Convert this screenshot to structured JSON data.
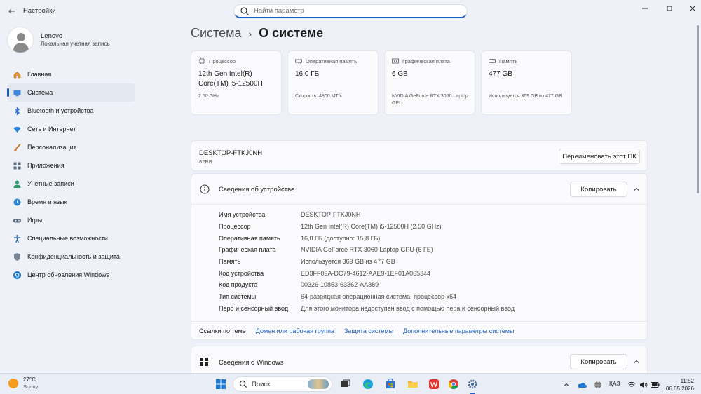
{
  "window": {
    "title": "Настройки",
    "search_placeholder": "Найти параметр"
  },
  "profile": {
    "name": "Lenovo",
    "account_type": "Локальная учетная запись"
  },
  "sidebar": {
    "items": [
      {
        "label": "Главная",
        "icon": "home-icon"
      },
      {
        "label": "Система",
        "icon": "system-icon",
        "active": true
      },
      {
        "label": "Bluetooth и устройства",
        "icon": "bluetooth-icon"
      },
      {
        "label": "Сеть и Интернет",
        "icon": "wifi-icon"
      },
      {
        "label": "Персонализация",
        "icon": "brush-icon"
      },
      {
        "label": "Приложения",
        "icon": "apps-icon"
      },
      {
        "label": "Учетные записи",
        "icon": "accounts-icon"
      },
      {
        "label": "Время и язык",
        "icon": "time-language-icon"
      },
      {
        "label": "Игры",
        "icon": "gaming-icon"
      },
      {
        "label": "Специальные возможности",
        "icon": "accessibility-icon"
      },
      {
        "label": "Конфиденциальность и защита",
        "icon": "shield-icon"
      },
      {
        "label": "Центр обновления Windows",
        "icon": "update-icon"
      }
    ]
  },
  "breadcrumb": {
    "parent": "Система",
    "separator": "›",
    "current": "О системе"
  },
  "cards": [
    {
      "label": "Процессор",
      "value": "12th Gen Intel(R) Core(TM) i5-12500H",
      "sub": "2.50 GHz",
      "icon": "cpu-icon"
    },
    {
      "label": "Оперативная память",
      "value": "16,0 ГБ",
      "sub": "Скорость: 4800 МТ/с",
      "icon": "ram-icon"
    },
    {
      "label": "Графическая плата",
      "value": "6 GB",
      "sub": "NVIDIA GeForce RTX 3060 Laptop GPU",
      "icon": "gpu-icon"
    },
    {
      "label": "Память",
      "value": "477 GB",
      "sub": "Используется 369 GB из 477 GB",
      "icon": "storage-icon"
    }
  ],
  "pc": {
    "name": "DESKTOP-FTKJ0NH",
    "model": "82RB",
    "rename_label": "Переименовать этот ПК"
  },
  "device_specs": {
    "title": "Сведения об устройстве",
    "copy_label": "Копировать",
    "rows": [
      {
        "key": "Имя устройства",
        "value": "DESKTOP-FTKJ0NH"
      },
      {
        "key": "Процессор",
        "value": "12th Gen Intel(R) Core(TM) i5-12500H (2.50 GHz)"
      },
      {
        "key": "Оперативная память",
        "value": "16,0 ГБ (доступно: 15,8 ГБ)"
      },
      {
        "key": "Графическая плата",
        "value": "NVIDIA GeForce RTX 3060 Laptop GPU (6 ГБ)"
      },
      {
        "key": "Память",
        "value": "Используется 369 GB из 477 GB"
      },
      {
        "key": "Код устройства",
        "value": "ED3FF09A-DC79-4612-AAE9-1EF01A065344"
      },
      {
        "key": "Код продукта",
        "value": "00326-10853-63362-AA889"
      },
      {
        "key": "Тип системы",
        "value": "64-разрядная операционная система, процессор x64"
      },
      {
        "key": "Перо и сенсорный ввод",
        "value": "Для этого монитора недоступен ввод с помощью пера и сенсорный ввод"
      }
    ],
    "links_label": "Ссылки по теме",
    "links": [
      "Домен или рабочая группа",
      "Защита системы",
      "Дополнительные параметры системы"
    ]
  },
  "windows_specs": {
    "title": "Сведения о Windows",
    "copy_label": "Копировать"
  },
  "taskbar": {
    "weather_temp": "27°C",
    "weather_condition": "Sunny",
    "search_label": "Поиск",
    "language": "ҚАЗ",
    "time": "11:52",
    "date": "06.05.2026"
  },
  "colors": {
    "accent": "#1f5fc4",
    "background": "#eef1f7"
  }
}
